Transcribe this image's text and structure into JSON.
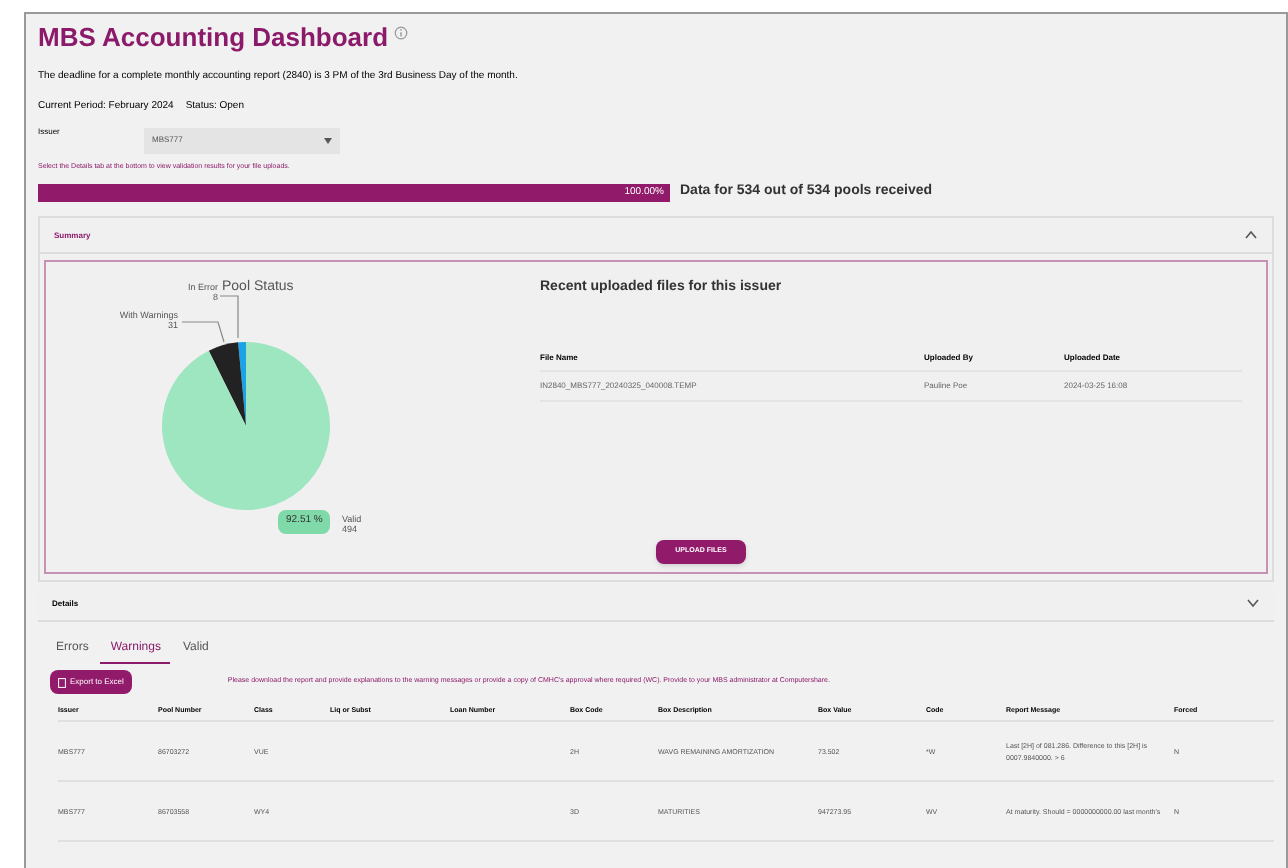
{
  "title": "MBS Accounting Dashboard",
  "deadline": "The deadline for a complete monthly accounting report (2840) is 3 PM of the 3rd Business Day of the month.",
  "current_period": "Current Period: February 2024",
  "status": "Status: Open",
  "issuer": {
    "label": "Issuer",
    "value": "MBS777"
  },
  "hint": "Select the Details tab at the bottom to view validation results for your file uploads.",
  "progress": {
    "level": 1.0,
    "reading": "100.00%",
    "caption": "Data for 534 out of 534 pools received"
  },
  "summary": {
    "title": "Summary",
    "expanded": true,
    "chart": {
      "chart_data": {
        "type": "pie",
        "title": "Pool Status",
        "categories": [
          "In Error",
          "With Warnings",
          "Valid"
        ],
        "series": [
          {
            "values": [
              8,
              31,
              494
            ]
          }
        ],
        "colors": [
          "#1aa3e8",
          "#222222",
          "#9de6bf"
        ],
        "data_labels": true
      },
      "percent_badge": "92.51 %"
    },
    "files_title": "Recent uploaded files for this issuer",
    "columns": [
      "File Name",
      "Uploaded By",
      "Uploaded Date"
    ],
    "rows": [
      [
        "IN2840_MBS777_20240325_040008.TEMP",
        "Pauline Poe",
        "2024-03-25 16:08"
      ]
    ],
    "upload_button": "UPLOAD FILES"
  },
  "details": {
    "title": "Details",
    "expanded": false,
    "tabs": [
      {
        "label": "Errors",
        "selected": false
      },
      {
        "label": "Warnings",
        "selected": true
      },
      {
        "label": "Valid",
        "selected": false
      }
    ],
    "export_button": "Export to Excel",
    "notice": "Please download the report and provide explanations to the warning messages or provide a copy of CMHC's approval where required (WC). Provide to your MBS administrator at Computershare.",
    "columns": [
      "Issuer",
      "Pool Number",
      "Class",
      "Liq or Subst",
      "Loan Number",
      "Box Code",
      "Box Description",
      "Box Value",
      "Code",
      "Report Message",
      "Forced"
    ],
    "rows": [
      [
        "MBS777",
        "86703272",
        "VUE",
        "",
        "",
        "2H",
        "WAVG REMAINING AMORTIZATION",
        "73.502",
        "*W",
        "Last [2H] of 081.286. Difference to this [2H] is 0007.9840000. > 6",
        "N"
      ],
      [
        "MBS777",
        "86703558",
        "WY4",
        "",
        "",
        "3D",
        "MATURITIES",
        "947273.95",
        "WV",
        "At maturity. Should = 0000000000.00 last month's",
        "N"
      ]
    ]
  }
}
